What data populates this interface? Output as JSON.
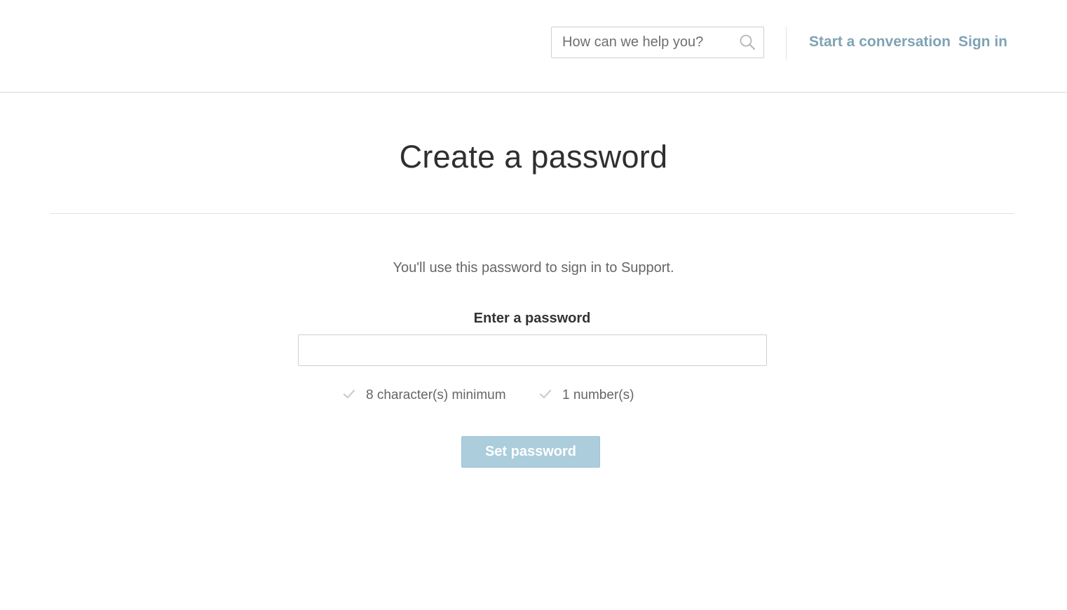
{
  "header": {
    "search": {
      "placeholder": "How can we help you?",
      "icon": "search-icon"
    },
    "nav": {
      "start_conversation": "Start a conversation",
      "sign_in": "Sign in"
    },
    "link_color": "#7fa3b5"
  },
  "main": {
    "title": "Create a password",
    "intro": "You'll use this password to sign in to Support.",
    "password_label": "Enter a password",
    "password_value": "",
    "requirements": [
      {
        "label": "8 character(s) minimum",
        "icon": "check-icon",
        "met": false
      },
      {
        "label": "1 number(s)",
        "icon": "check-icon",
        "met": false
      }
    ],
    "submit_label": "Set password",
    "submit_enabled": false,
    "button_color": "#abcddc"
  }
}
